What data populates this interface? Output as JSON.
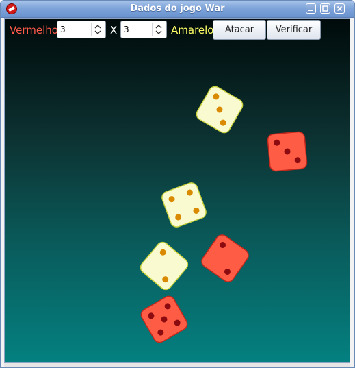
{
  "window": {
    "title": "Dados do jogo War"
  },
  "toolbar": {
    "attacker_label": "Vermelho",
    "attacker_count": "3",
    "versus_label": "X",
    "defender_count": "3",
    "defender_label": "Amarelo",
    "attack_button": "Atacar",
    "verify_button": "Verificar"
  },
  "colors": {
    "attacker_text": "#ff5a4a",
    "defender_text": "#ffff66",
    "red_die": "#ff5c45",
    "red_pip": "#8b0b10",
    "yellow_die": "#fafad0",
    "yellow_pip": "#d98a00"
  },
  "dice": {
    "yellow": [
      {
        "value": 3,
        "angle": 30
      },
      {
        "value": 4,
        "angle": -20
      },
      {
        "value": 2,
        "angle": 40
      }
    ],
    "red": [
      {
        "value": 3,
        "angle": -5
      },
      {
        "value": 2,
        "angle": 35
      },
      {
        "value": 5,
        "angle": -30
      }
    ]
  },
  "icons": {
    "app": "dice-app-icon",
    "minimize": "minimize-icon",
    "maximize": "maximize-icon",
    "close": "close-icon",
    "spin": "spin-up-down-icon"
  }
}
